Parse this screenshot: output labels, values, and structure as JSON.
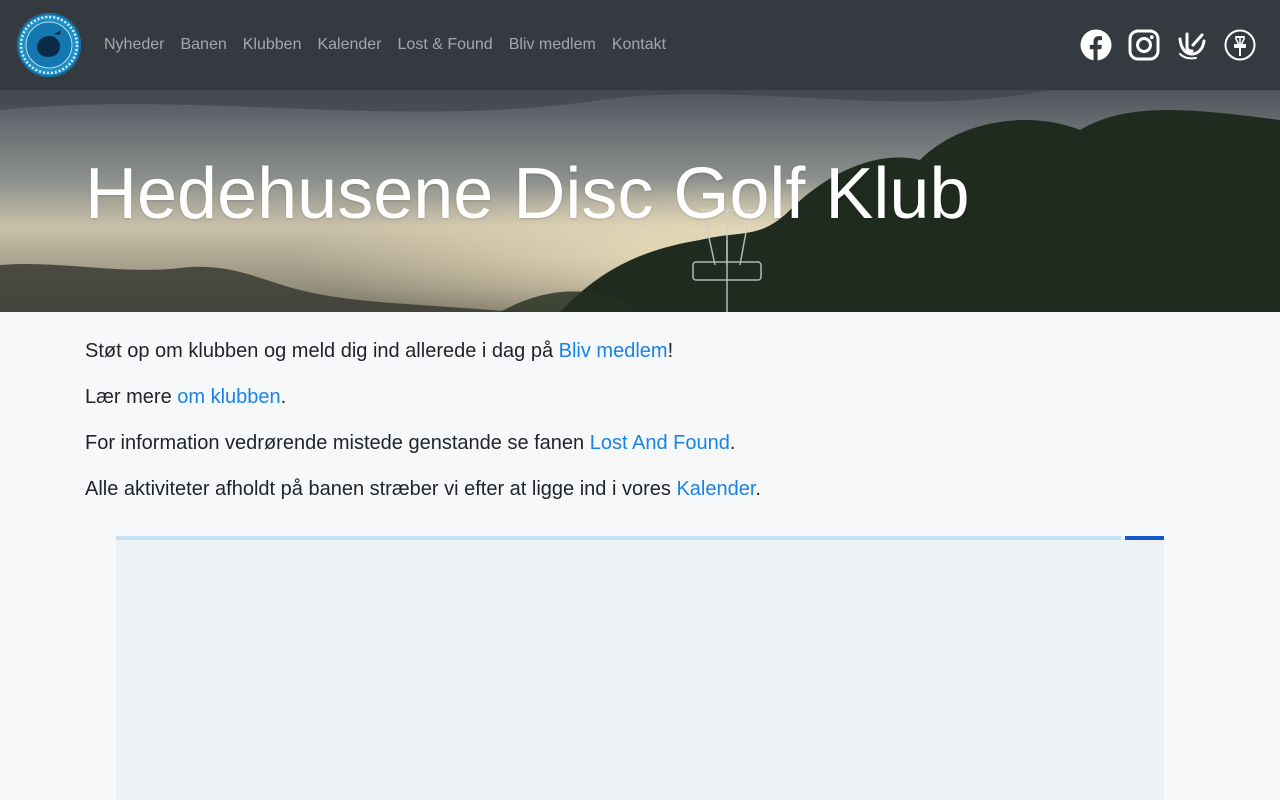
{
  "navbar": {
    "logo_text": "HEDEHUSENE DISC GOLF KLUB · EST 2021",
    "links": [
      {
        "label": "Nyheder"
      },
      {
        "label": "Banen"
      },
      {
        "label": "Klubben"
      },
      {
        "label": "Kalender"
      },
      {
        "label": "Lost & Found"
      },
      {
        "label": "Bliv medlem"
      },
      {
        "label": "Kontakt"
      }
    ],
    "social": [
      {
        "icon": "facebook-icon"
      },
      {
        "icon": "instagram-icon"
      },
      {
        "icon": "udisc-icon"
      },
      {
        "icon": "disc-golf-basket-icon"
      }
    ]
  },
  "hero": {
    "title": "Hedehusene Disc Golf Klub"
  },
  "content": {
    "p1": {
      "before": "Støt op om klubben og meld dig ind allerede i dag på ",
      "link": "Bliv medlem",
      "after": "!"
    },
    "p2": {
      "before": "Lær mere ",
      "link": "om klubben",
      "after": "."
    },
    "p3": {
      "before": "For information vedrørende mistede genstande se fanen ",
      "link": "Lost And Found",
      "after": "."
    },
    "p4": {
      "before": "Alle aktiviteter afholdt på banen stræber vi efter at ligge ind i vores ",
      "link": "Kalender",
      "after": "."
    }
  },
  "colors": {
    "navbar_bg": "#343a40",
    "link": "#1a83e6",
    "page_bg": "#f6f8fa",
    "embed_progress": "#1259c9"
  }
}
